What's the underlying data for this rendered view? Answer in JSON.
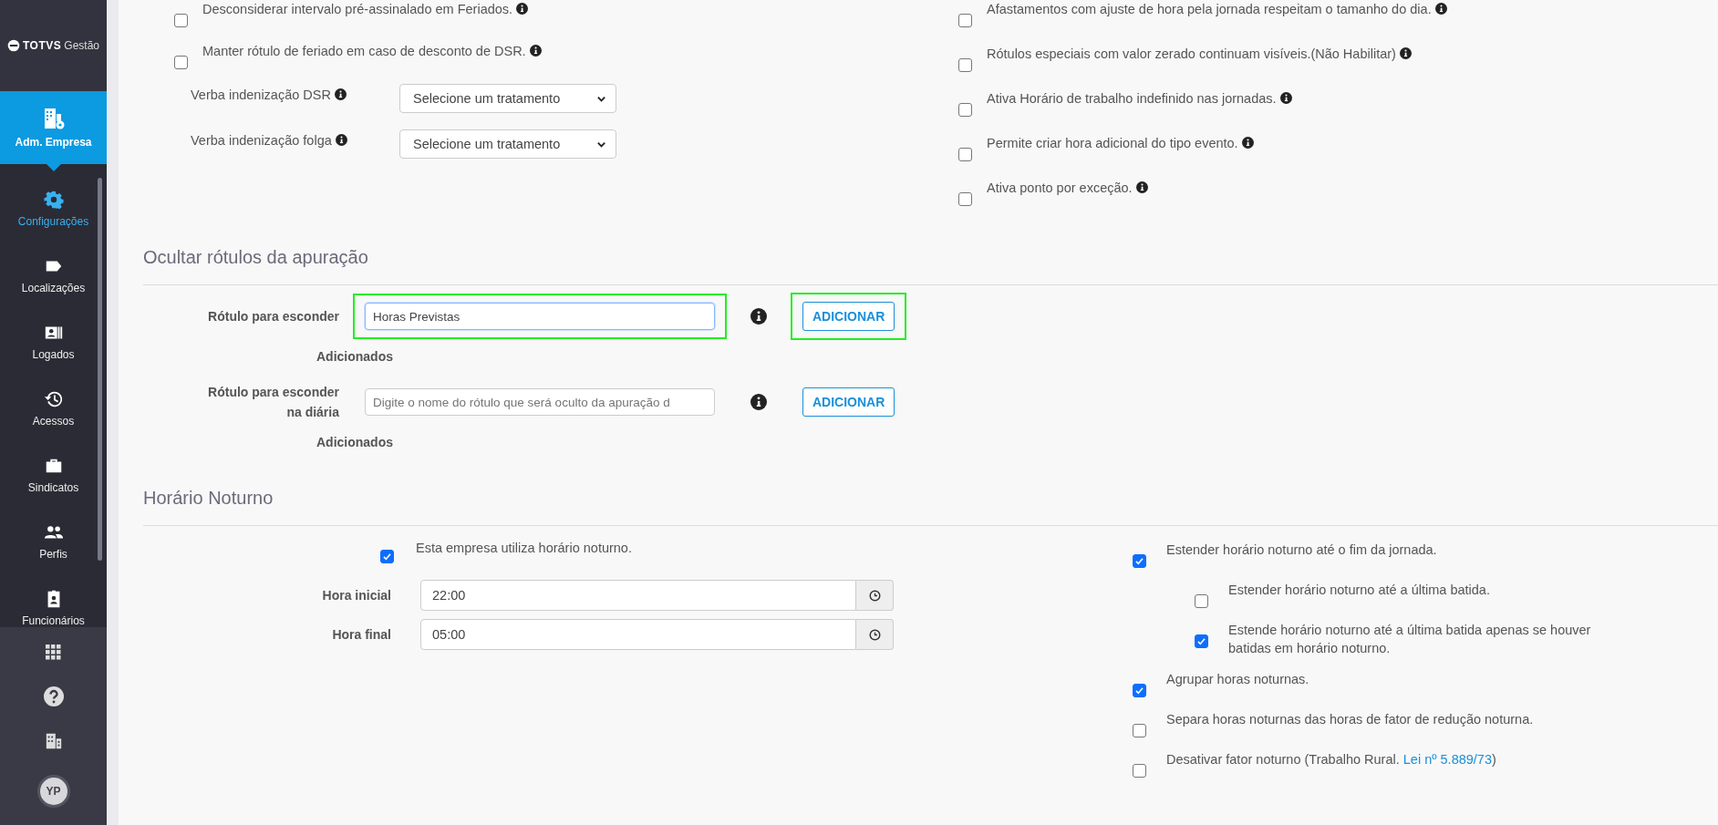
{
  "sidebar": {
    "logo": {
      "brand": "TOTVS",
      "product": "Gestão"
    },
    "module": {
      "label": "Adm. Empresa",
      "selected": true
    },
    "items": [
      {
        "label": "Configurações",
        "selected": true
      },
      {
        "label": "Localizações",
        "selected": false
      },
      {
        "label": "Logados",
        "selected": false
      },
      {
        "label": "Acessos",
        "selected": false
      },
      {
        "label": "Sindicatos",
        "selected": false
      },
      {
        "label": "Perfis",
        "selected": false
      },
      {
        "label": "Funcionários",
        "selected": false
      }
    ],
    "avatar": "YP"
  },
  "general": {
    "left_checks": [
      {
        "label": "Desconsiderar intervalo pré-assinalado em Feriados.",
        "checked": false,
        "info": true
      },
      {
        "label": "Manter rótulo de feriado em caso de desconto de DSR.",
        "checked": false,
        "info": true
      }
    ],
    "selects": [
      {
        "label": "Verba indenização DSR",
        "info": true,
        "value": "Selecione um tratamento"
      },
      {
        "label": "Verba indenização folga",
        "info": true,
        "value": "Selecione um tratamento"
      }
    ],
    "right_checks": [
      {
        "label": "Afastamentos com ajuste de hora pela jornada respeitam o tamanho do dia.",
        "checked": false,
        "info": true
      },
      {
        "label": "Rótulos especiais com valor zerado continuam visíveis.(Não Habilitar)",
        "checked": false,
        "info": true
      },
      {
        "label": "Ativa Horário de trabalho indefinido nas jornadas.",
        "checked": false,
        "info": true
      },
      {
        "label": "Permite criar hora adicional do tipo evento.",
        "checked": false,
        "info": true
      },
      {
        "label": "Ativa ponto por exceção.",
        "checked": false,
        "info": true
      }
    ]
  },
  "hide_labels": {
    "title": "Ocultar rótulos da apuração",
    "rows": [
      {
        "label": "Rótulo para esconder",
        "value": "Horas Previstas",
        "focused": true,
        "field_highlighted": true,
        "button": "ADICIONAR",
        "button_highlighted": true,
        "added_label": "Adicionados"
      },
      {
        "label": "Rótulo para esconder na diária",
        "placeholder": "Digite o nome do rótulo que será oculto da apuração d",
        "focused": false,
        "button": "ADICIONAR",
        "added_label": "Adicionados"
      }
    ]
  },
  "night": {
    "title": "Horário Noturno",
    "uses_night": {
      "label": "Esta empresa utiliza horário noturno.",
      "checked": true
    },
    "times": [
      {
        "label": "Hora inicial",
        "value": "22:00"
      },
      {
        "label": "Hora final",
        "value": "05:00"
      }
    ],
    "options": [
      {
        "label": "Estender horário noturno até o fim da jornada.",
        "checked": true,
        "children": [
          {
            "label": "Estender horário noturno até a última batida.",
            "checked": false
          },
          {
            "label": "Estende horário noturno até a última batida apenas se houver batidas em horário noturno.",
            "checked": true
          }
        ]
      },
      {
        "label": "Agrupar horas noturnas.",
        "checked": true
      },
      {
        "label": "Separa horas noturnas das horas de fator de redução noturna.",
        "checked": false
      },
      {
        "label": "Desativar fator noturno (Trabalho Rural. ",
        "link": "Lei nº 5.889/73",
        "suffix": ")",
        "checked": false
      }
    ]
  }
}
